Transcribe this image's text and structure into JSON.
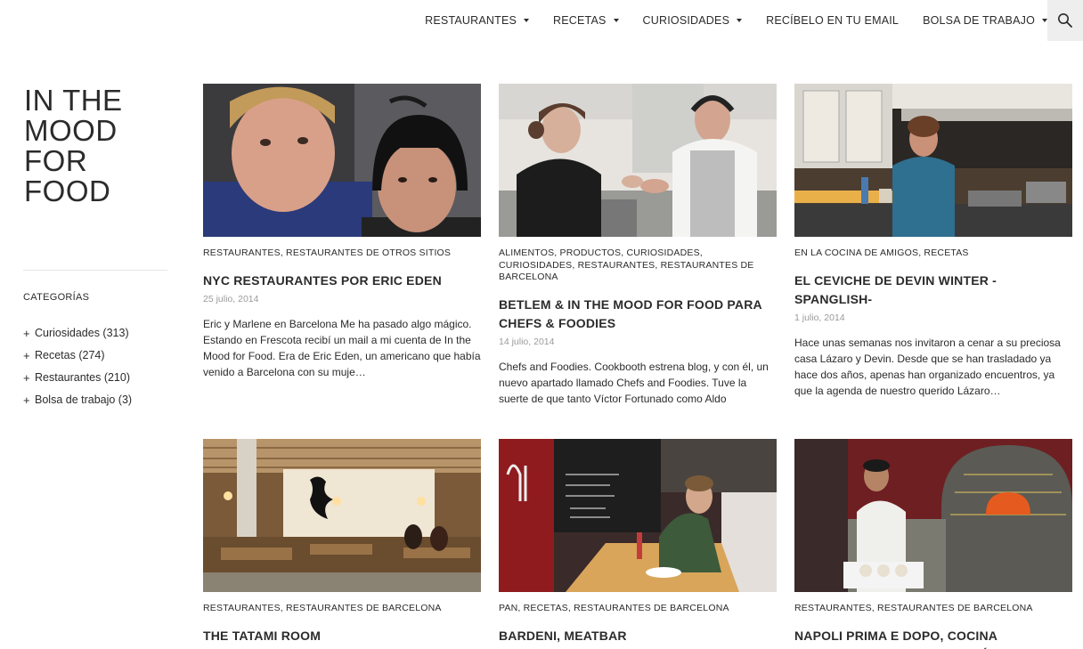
{
  "nav": {
    "items": [
      {
        "label": "RESTAURANTES",
        "has_dropdown": true
      },
      {
        "label": "RECETAS",
        "has_dropdown": true
      },
      {
        "label": "CURIOSIDADES",
        "has_dropdown": true
      },
      {
        "label": "RECÍBELO EN TU EMAIL",
        "has_dropdown": false
      },
      {
        "label": "BOLSA DE TRABAJO",
        "has_dropdown": true
      }
    ],
    "search_icon": "search-icon"
  },
  "site": {
    "title_lines": [
      "IN THE",
      "MOOD",
      "FOR",
      "FOOD"
    ]
  },
  "sidebar": {
    "heading": "CATEGORÍAS",
    "items": [
      {
        "label": "Curiosidades (313)"
      },
      {
        "label": "Recetas (274)"
      },
      {
        "label": "Restaurantes (210)"
      },
      {
        "label": "Bolsa de trabajo (3)"
      }
    ]
  },
  "posts": [
    {
      "categories": "RESTAURANTES, RESTAURANTES DE OTROS SITIOS",
      "title": "NYC RESTAURANTES POR ERIC EDEN",
      "date": "25 julio, 2014",
      "excerpt": "Eric y Marlene en Barcelona Me ha pasado algo mágico. Estando en Frescota recibí un mail a mi cuenta de In the Mood for Food. Era de Eric Eden, un americano que había venido a Barcelona con su muje…"
    },
    {
      "categories": "ALIMENTOS, PRODUCTOS, CURIOSIDADES, CURIOSIDADES, RESTAURANTES, RESTAURANTES DE BARCELONA",
      "title": "BETLEM & IN THE MOOD FOR FOOD PARA CHEFS & FOODIES",
      "date": "14 julio, 2014",
      "excerpt": "Chefs and Foodies. Cookbooth estrena blog, y con él, un nuevo apartado llamado Chefs and Foodies. Tuve la suerte de que tanto Víctor Fortunado como Aldo"
    },
    {
      "categories": "EN LA COCINA DE AMIGOS, RECETAS",
      "title": "EL CEVICHE DE DEVIN WINTER -SPANGLISH-",
      "date": "1 julio, 2014",
      "excerpt": "Hace unas semanas nos invitaron a cenar a su preciosa casa Lázaro y Devin. Desde que se han trasladado ya hace dos años, apenas han organizado encuentros, ya que la agenda de nuestro querido Lázaro…"
    },
    {
      "categories": "RESTAURANTES, RESTAURANTES DE BARCELONA",
      "title": "THE TATAMI ROOM",
      "date": "",
      "excerpt": ""
    },
    {
      "categories": "PAN, RECETAS, RESTAURANTES DE BARCELONA",
      "title": "BARDENI, MEATBAR",
      "date": "",
      "excerpt": ""
    },
    {
      "categories": "RESTAURANTES, RESTAURANTES DE BARCELONA",
      "title": "NAPOLI PRIMA E DOPO, COCINA TRADICIONAL Y CONTEMPORÁNEA",
      "date": "",
      "excerpt": ""
    }
  ]
}
